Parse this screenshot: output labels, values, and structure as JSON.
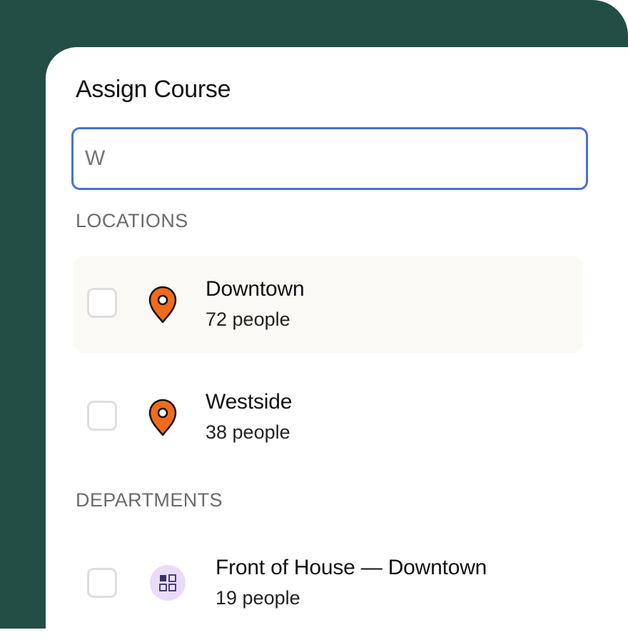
{
  "dialog": {
    "title": "Assign Course",
    "search": {
      "value": "W"
    }
  },
  "sections": [
    {
      "label": "LOCATIONS",
      "items": [
        {
          "name": "Downtown",
          "count": "72 people",
          "icon": "map-pin-icon",
          "checked": false
        },
        {
          "name": "Westside",
          "count": "38 people",
          "icon": "map-pin-icon",
          "checked": false
        }
      ]
    },
    {
      "label": "DEPARTMENTS",
      "items": [
        {
          "name": "Front of House — Downtown",
          "count": "19 people",
          "icon": "grid-icon",
          "checked": false
        }
      ]
    }
  ],
  "colors": {
    "backdrop": "#234e45",
    "search_border": "#4a6fd8",
    "pin": "#f26b1d",
    "dept_icon_bg": "#e9dcfa",
    "dept_icon_fg": "#3a2f6b"
  }
}
